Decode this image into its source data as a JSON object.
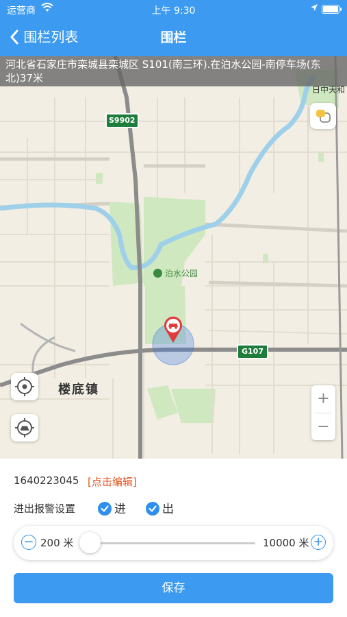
{
  "status": {
    "carrier": "运营商",
    "time": "上午 9:30"
  },
  "nav": {
    "back_label": "围栏列表",
    "title": "围栏"
  },
  "map": {
    "address": "河北省石家庄市栾城县栾城区 S101(南三环).在泊水公园-南停车场(东北)37米",
    "labels": {
      "road_s9902": "S9902",
      "road_g107": "G107",
      "park": "泊水公园",
      "town": "楼底镇",
      "poi_top": "日中天和"
    },
    "zoom_in": "+",
    "zoom_out": "−"
  },
  "panel": {
    "device_id": "1640223045",
    "edit_link": "[点击编辑]",
    "alarm_label": "进出报警设置",
    "check_in": "进",
    "check_out": "出",
    "radius_min": "200 米",
    "radius_max": "10000 米",
    "radius_value_fraction": 0.0,
    "save_label": "保存"
  }
}
